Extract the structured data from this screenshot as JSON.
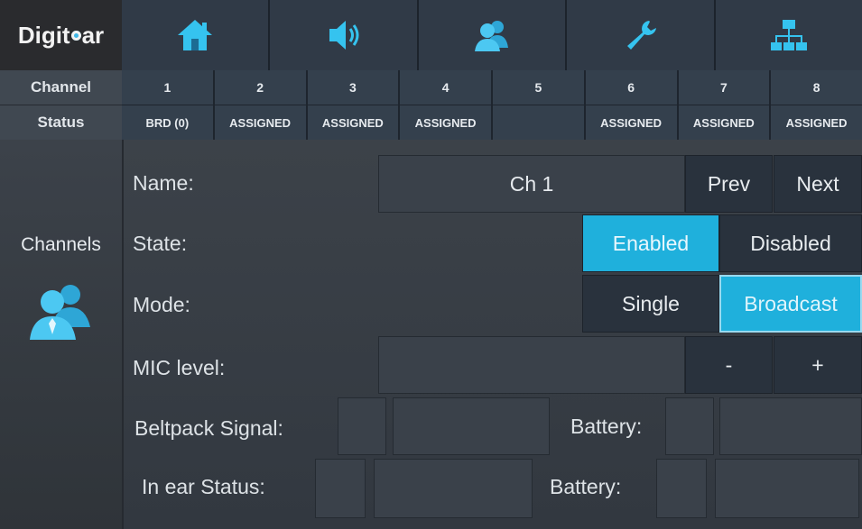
{
  "brand": {
    "name_prefix": "",
    "logo_text": "igit",
    "logo_text_end": "ar",
    "logo_first": "D"
  },
  "nav": {
    "items": [
      {
        "icon": "home-icon"
      },
      {
        "icon": "speaker-icon"
      },
      {
        "icon": "users-icon"
      },
      {
        "icon": "wrench-icon"
      },
      {
        "icon": "network-icon"
      }
    ]
  },
  "channel_row": {
    "label": "Channel",
    "channels": [
      "1",
      "2",
      "3",
      "4",
      "5",
      "6",
      "7",
      "8"
    ]
  },
  "status_row": {
    "label": "Status",
    "statuses": [
      "BRD (0)",
      "ASSIGNED",
      "ASSIGNED",
      "ASSIGNED",
      "",
      "ASSIGNED",
      "ASSIGNED",
      "ASSIGNED"
    ]
  },
  "sidebar": {
    "label": "Channels",
    "icon": "users-icon"
  },
  "form": {
    "name_label": "Name:",
    "name_value": "Ch 1",
    "prev_label": "Prev",
    "next_label": "Next",
    "state_label": "State:",
    "enabled_label": "Enabled",
    "disabled_label": "Disabled",
    "mode_label": "Mode:",
    "single_label": "Single",
    "broadcast_label": "Broadcast",
    "mic_label": "MIC level:",
    "minus_label": "-",
    "plus_label": "+",
    "beltpack_label": "Beltpack  Signal:",
    "beltpack_battery_label": "Battery:",
    "inear_label": "In ear  Status:",
    "inear_battery_label": "Battery:"
  },
  "colors": {
    "accent": "#1fb0dc",
    "background": "#33373d",
    "button": "#29323d"
  }
}
